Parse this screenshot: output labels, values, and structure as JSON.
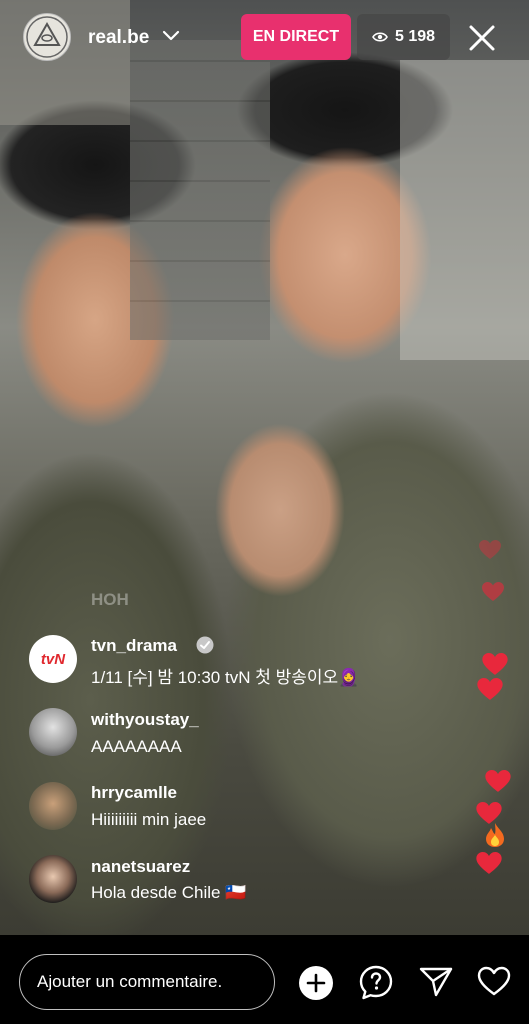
{
  "header": {
    "username": "real.be",
    "live_label": "EN DIRECT",
    "viewers": "5 198"
  },
  "faded_text": "HOH",
  "comments": [
    {
      "user": "tvn_drama",
      "text": "1/11 [수] 밤 10:30 tvN 첫 방송이오🧕",
      "avatar_text": "tvN",
      "verified": true
    },
    {
      "user": "withyoustay_",
      "text": "AAAAAAAA"
    },
    {
      "user": "hrrycamlle",
      "text": "Hiiiiiiiii min jaee"
    },
    {
      "user": "nanetsuarez",
      "text": "Hola desde Chile 🇨🇱"
    }
  ],
  "bottom": {
    "comment_placeholder": "Ajouter un commentaire."
  },
  "colors": {
    "live_badge": "#e8306e",
    "heart": "#e8283c"
  },
  "icons": [
    "chevron-down-icon",
    "eye-icon",
    "close-icon",
    "verified-icon",
    "plus-icon",
    "question-icon",
    "send-icon",
    "heart-icon"
  ]
}
